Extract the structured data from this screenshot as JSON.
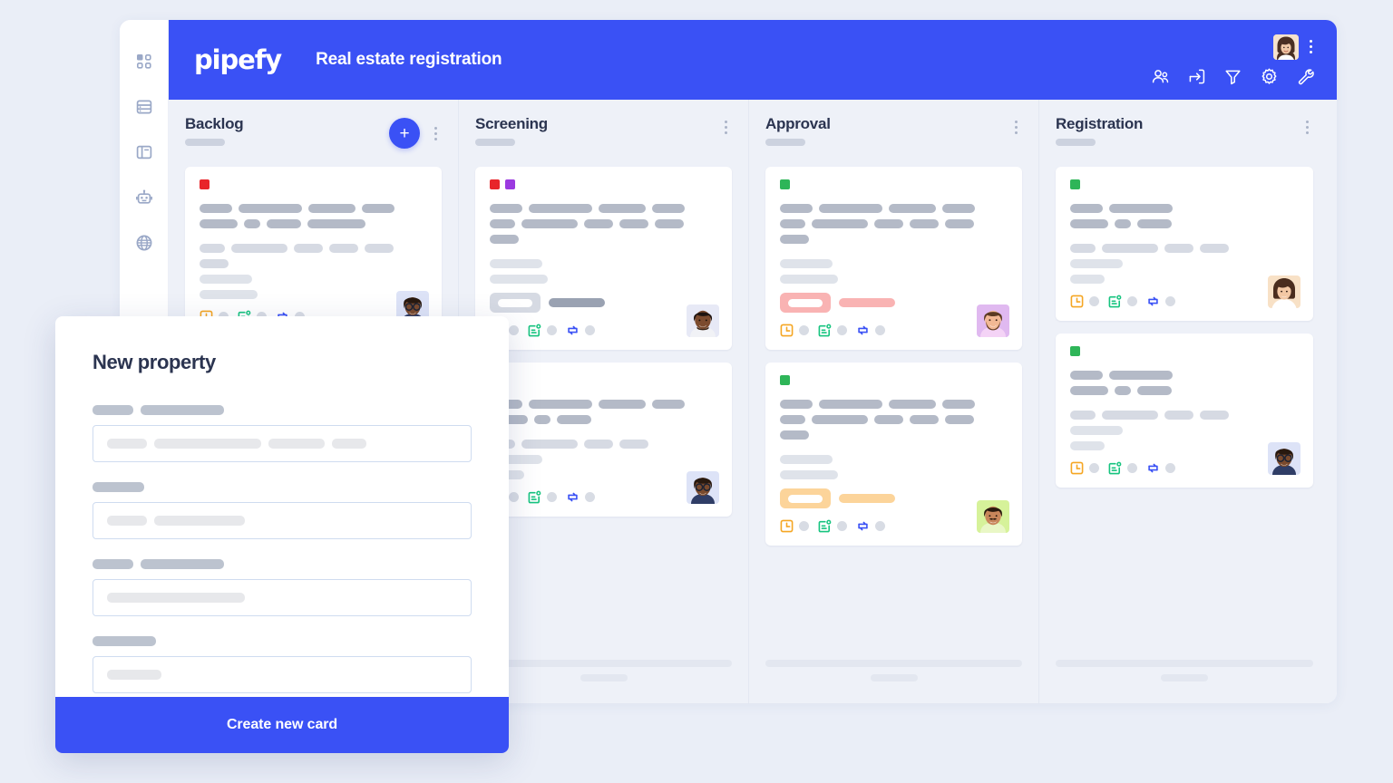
{
  "app": {
    "brand": "pipefy",
    "board_title": "Real estate registration"
  },
  "sidebar": {
    "items": [
      {
        "icon": "dashboard-grid-icon",
        "label": "Dashboard"
      },
      {
        "icon": "database-icon",
        "label": "Database"
      },
      {
        "icon": "layout-panel-icon",
        "label": "Templates"
      },
      {
        "icon": "robot-automation-icon",
        "label": "Automations"
      },
      {
        "icon": "globe-icon",
        "label": "Portals"
      }
    ]
  },
  "topbar": {
    "icons": [
      {
        "icon": "members-icon",
        "label": "Members"
      },
      {
        "icon": "import-archive-icon",
        "label": "Import"
      },
      {
        "icon": "filter-icon",
        "label": "Filter"
      },
      {
        "icon": "gear-icon",
        "label": "Settings"
      },
      {
        "icon": "wrench-icon",
        "label": "Tools"
      }
    ],
    "avatar": "user-avatar",
    "menu": "more-options"
  },
  "columns": [
    {
      "name": "Backlog",
      "has_add_button": true,
      "add_label": "+",
      "cards": [
        {
          "tags": [
            "#e8252a"
          ],
          "title_bars": [
            36,
            70,
            52,
            36
          ],
          "subtitle_bars": [
            42,
            18,
            38,
            64
          ],
          "meta_bars": [
            28,
            62,
            32,
            32,
            32,
            32
          ],
          "line_bars": [
            58,
            64
          ],
          "pill": null,
          "avatar": "avatar-glasses-man"
        },
        {
          "tags": [],
          "title_bars": [
            36,
            70,
            52,
            36
          ],
          "subtitle_bars": [
            42,
            18,
            38,
            64
          ],
          "meta_bars": [
            28,
            62,
            32,
            32,
            32,
            32
          ],
          "line_bars": [
            58,
            64
          ],
          "pill": null,
          "avatar": "avatar-glasses-man"
        }
      ]
    },
    {
      "name": "Screening",
      "has_add_button": false,
      "cards": [
        {
          "tags": [
            "#e8252a",
            "#9b3ae0"
          ],
          "title_bars": [
            36,
            70,
            52,
            36
          ],
          "subtitle_bars": [
            28,
            62,
            32,
            32,
            32,
            32
          ],
          "meta_bars": [],
          "line_bars": [
            58,
            64
          ],
          "pill": {
            "style": "gray"
          },
          "avatar": "avatar-smiling-man"
        },
        {
          "tags": [],
          "title_bars": [
            36,
            70,
            52,
            36
          ],
          "subtitle_bars": [
            42,
            18,
            38
          ],
          "meta_bars": [
            28,
            62,
            32,
            32
          ],
          "line_bars": [
            58,
            38
          ],
          "pill": null,
          "avatar": "avatar-glasses-man"
        }
      ]
    },
    {
      "name": "Approval",
      "has_add_button": false,
      "cards": [
        {
          "tags": [
            "#2eb558"
          ],
          "title_bars": [
            36,
            70,
            52,
            36
          ],
          "subtitle_bars": [
            28,
            62,
            32,
            32,
            32,
            32
          ],
          "meta_bars": [],
          "line_bars": [
            58,
            64
          ],
          "pill": {
            "style": "red"
          },
          "avatar": "avatar-bearded-man"
        },
        {
          "tags": [
            "#2eb558"
          ],
          "title_bars": [
            36,
            70,
            52,
            36
          ],
          "subtitle_bars": [
            28,
            62,
            32,
            32,
            32,
            32
          ],
          "meta_bars": [],
          "line_bars": [
            58,
            64
          ],
          "pill": {
            "style": "amber"
          },
          "avatar": "avatar-mustache-man"
        }
      ]
    },
    {
      "name": "Registration",
      "has_add_button": false,
      "cards": [
        {
          "tags": [
            "#2eb558"
          ],
          "title_bars": [
            36,
            70
          ],
          "subtitle_bars": [
            42,
            18,
            38
          ],
          "meta_bars": [
            28,
            62,
            32,
            32
          ],
          "line_bars": [
            58,
            38
          ],
          "pill": null,
          "avatar": "avatar-smiling-woman"
        },
        {
          "tags": [
            "#2eb558"
          ],
          "title_bars": [
            36,
            70
          ],
          "subtitle_bars": [
            42,
            18,
            38
          ],
          "meta_bars": [
            28,
            62,
            32,
            32
          ],
          "line_bars": [
            58,
            38
          ],
          "pill": null,
          "avatar": "avatar-glasses-man"
        }
      ]
    }
  ],
  "card_footer_icons": [
    {
      "icon": "due-date-clock-icon",
      "color": "#f5a623"
    },
    {
      "icon": "calendar-check-icon",
      "color": "#16c47f"
    },
    {
      "icon": "connected-cards-icon",
      "color": "#3a51f5"
    }
  ],
  "modal": {
    "title": "New property",
    "submit_label": "Create new card",
    "fields": [
      {
        "label_bars": [
          45,
          92
        ],
        "input_bars": [
          44,
          118,
          62,
          38
        ]
      },
      {
        "label_bars": [
          57
        ],
        "input_bars": [
          44,
          100
        ]
      },
      {
        "label_bars": [
          45,
          92
        ],
        "input_bars": [
          152
        ]
      },
      {
        "label_bars": [
          70
        ],
        "input_bars": [
          60
        ]
      }
    ]
  },
  "colors": {
    "brand_blue": "#3a51f5",
    "page_bg": "#eaeef7",
    "board_bg": "#eef1f8",
    "card_bg": "#ffffff",
    "text_dark": "#2b3450",
    "skeleton": "#b4bac7"
  }
}
